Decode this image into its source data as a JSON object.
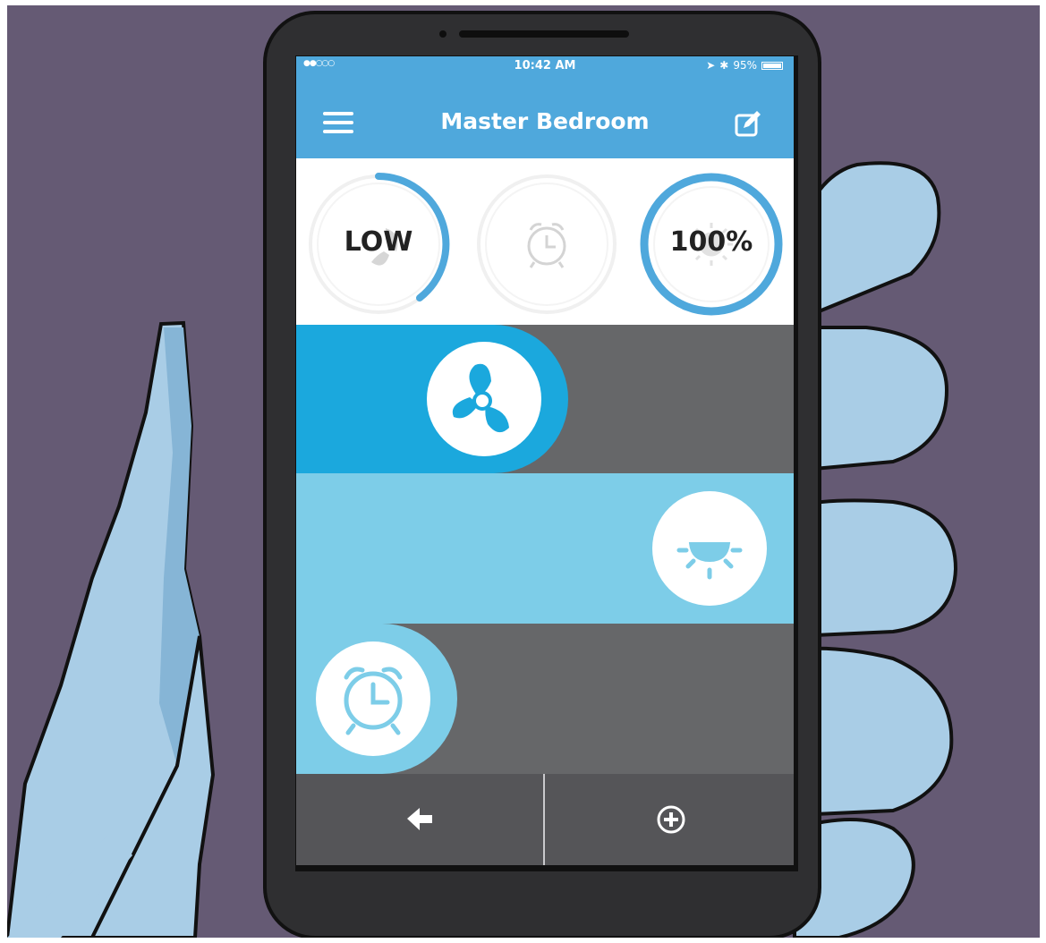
{
  "status_bar": {
    "signal": "●●○○○",
    "time": "10:42 AM",
    "battery": "95%"
  },
  "nav": {
    "title": "Master Bedroom",
    "menu_icon": "hamburger-menu-icon",
    "edit_icon": "edit-icon"
  },
  "gauges": [
    {
      "name": "fan-speed",
      "label": "LOW",
      "icon": "fan-icon",
      "level": 0.3
    },
    {
      "name": "alarm",
      "label": "",
      "icon": "alarm-clock-icon",
      "level": 0
    },
    {
      "name": "light-brightness",
      "label": "100%",
      "icon": "sun-icon",
      "level": 1.0
    }
  ],
  "rows": [
    {
      "name": "fan",
      "icon": "fan-icon",
      "level": 0.55
    },
    {
      "name": "light",
      "icon": "light-icon",
      "level": 1.0
    },
    {
      "name": "alarm",
      "icon": "alarm-clock-icon",
      "level": 0.3
    }
  ],
  "bottom_bar": {
    "back_icon": "arrow-left-icon",
    "add_icon": "plus-circle-icon"
  },
  "colors": {
    "background": "#655a74",
    "accent": "#4fa8dc",
    "fan_active": "#1ba8dd",
    "light_active": "#7dcde8",
    "inactive_row": "#666769",
    "hand": "#a9cde6",
    "phone": "#2f2f31"
  }
}
